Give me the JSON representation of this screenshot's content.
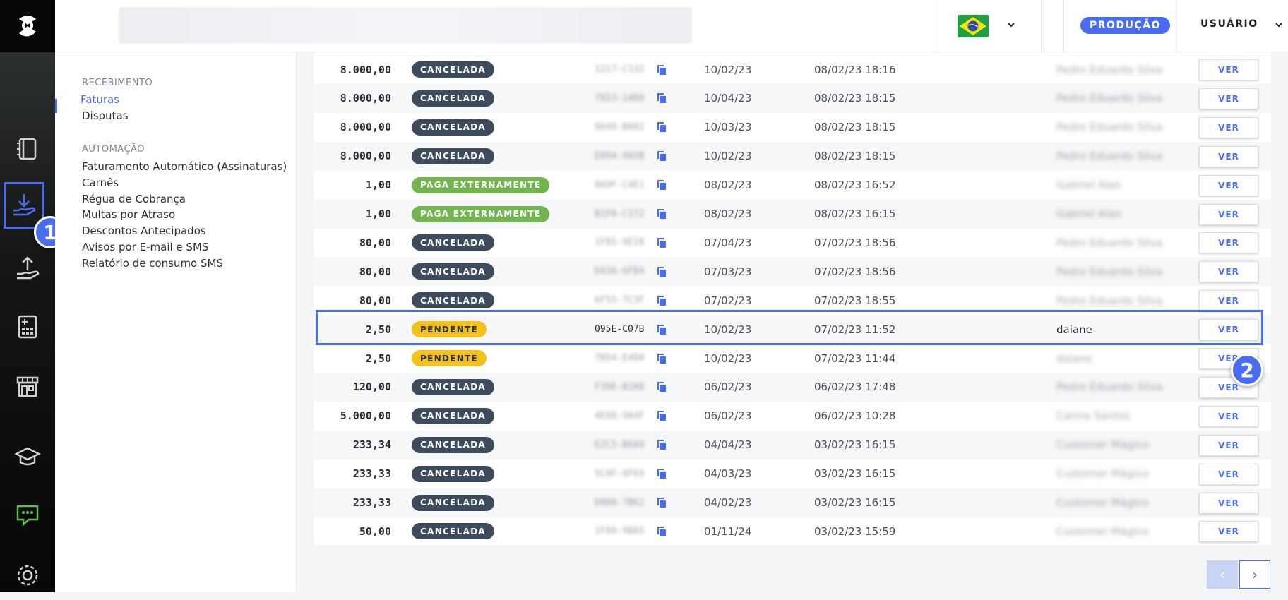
{
  "header": {
    "environment_badge": "PRODUÇÃO",
    "user_label": "USUÁRIO",
    "flag": "brazil-flag"
  },
  "sidebar_icons": [
    "logo-icon",
    "book-icon",
    "hand-receive-icon",
    "hand-pay-icon",
    "calculator-icon",
    "store-icon",
    "graduation-cap-icon",
    "chat-icon",
    "gear-icon"
  ],
  "subnav": {
    "sections": [
      {
        "title": "RECEBIMENTO",
        "items": [
          "Faturas",
          "Disputas"
        ]
      },
      {
        "title": "AUTOMAÇÃO",
        "items": [
          "Faturamento Automático (Assinaturas)",
          "Carnês",
          "Régua de Cobrança",
          "Multas por Atraso",
          "Descontos Antecipados",
          "Avisos por E-mail e SMS",
          "Relatório de consumo SMS"
        ]
      }
    ],
    "active_item": "Faturas"
  },
  "annotations": [
    "1",
    "2"
  ],
  "invoices": [
    {
      "amount": "8.000,00",
      "status": "CANCELADA",
      "status_type": "cancelada",
      "code": "1217-C132",
      "due": "10/02/23",
      "created": "08/02/23 18:16",
      "client": "Pedro Eduardo Silva",
      "action": "VER"
    },
    {
      "amount": "8.000,00",
      "status": "CANCELADA",
      "status_type": "cancelada",
      "code": "7853-1480",
      "due": "10/04/23",
      "created": "08/02/23 18:15",
      "client": "Pedro Eduardo Silva",
      "action": "VER"
    },
    {
      "amount": "8.000,00",
      "status": "CANCELADA",
      "status_type": "cancelada",
      "code": "9049-B802",
      "due": "10/03/23",
      "created": "08/02/23 18:15",
      "client": "Pedro Eduardo Silva",
      "action": "VER"
    },
    {
      "amount": "8.000,00",
      "status": "CANCELADA",
      "status_type": "cancelada",
      "code": "E094-9A5B",
      "due": "10/02/23",
      "created": "08/02/23 18:15",
      "client": "Pedro Eduardo Silva",
      "action": "VER"
    },
    {
      "amount": "1,00",
      "status": "PAGA EXTERNAMENTE",
      "status_type": "paga",
      "code": "8A9F-C4E1",
      "due": "08/02/23",
      "created": "08/02/23 16:52",
      "client": "Gabriel Alan",
      "action": "VER"
    },
    {
      "amount": "1,00",
      "status": "PAGA EXTERNAMENTE",
      "status_type": "paga",
      "code": "B1F0-C172",
      "due": "08/02/23",
      "created": "08/02/23 16:15",
      "client": "Gabriel Alan",
      "action": "VER"
    },
    {
      "amount": "80,00",
      "status": "CANCELADA",
      "status_type": "cancelada",
      "code": "1F85-9E18",
      "due": "07/04/23",
      "created": "07/02/23 18:56",
      "client": "Pedro Eduardo Silva",
      "action": "VER"
    },
    {
      "amount": "80,00",
      "status": "CANCELADA",
      "status_type": "cancelada",
      "code": "D43A-6FB4",
      "due": "07/03/23",
      "created": "07/02/23 18:56",
      "client": "Pedro Eduardo Silva",
      "action": "VER"
    },
    {
      "amount": "80,00",
      "status": "CANCELADA",
      "status_type": "cancelada",
      "code": "6F55-7C3F",
      "due": "07/02/23",
      "created": "07/02/23 18:55",
      "client": "Pedro Eduardo Silva",
      "action": "VER"
    },
    {
      "amount": "2,50",
      "status": "PENDENTE",
      "status_type": "pendente",
      "code": "095E-C07B",
      "due": "10/02/23",
      "created": "07/02/23 11:52",
      "client": "daiane",
      "action": "VER",
      "visible": true
    },
    {
      "amount": "2,50",
      "status": "PENDENTE",
      "status_type": "pendente",
      "code": "7B54-E480",
      "due": "10/02/23",
      "created": "07/02/23 11:44",
      "client": "daiane",
      "action": "VER"
    },
    {
      "amount": "120,00",
      "status": "CANCELADA",
      "status_type": "cancelada",
      "code": "F39E-B2A8",
      "due": "06/02/23",
      "created": "06/02/23 17:48",
      "client": "Pedro Eduardo Silva",
      "action": "VER"
    },
    {
      "amount": "5.000,00",
      "status": "CANCELADA",
      "status_type": "cancelada",
      "code": "4E08-9A4F",
      "due": "06/02/23",
      "created": "06/02/23 10:28",
      "client": "Carine Santos",
      "action": "VER"
    },
    {
      "amount": "233,34",
      "status": "CANCELADA",
      "status_type": "cancelada",
      "code": "E2C5-B6A9",
      "due": "04/04/23",
      "created": "03/02/23 16:15",
      "client": "Customer Mágico",
      "action": "VER"
    },
    {
      "amount": "233,33",
      "status": "CANCELADA",
      "status_type": "cancelada",
      "code": "5C4F-8F69",
      "due": "04/03/23",
      "created": "03/02/23 16:15",
      "client": "Customer Mágico",
      "action": "VER"
    },
    {
      "amount": "233,33",
      "status": "CANCELADA",
      "status_type": "cancelada",
      "code": "D88A-7B62",
      "due": "04/02/23",
      "created": "03/02/23 16:15",
      "client": "Customer Mágico",
      "action": "VER"
    },
    {
      "amount": "50,00",
      "status": "CANCELADA",
      "status_type": "cancelada",
      "code": "1F80-9BA5",
      "due": "01/11/24",
      "created": "03/02/23 15:59",
      "client": "Customer Mágico",
      "action": "VER"
    }
  ],
  "pager": {
    "prev": "‹",
    "next": "›"
  },
  "colors": {
    "accent": "#4a6cf0",
    "cancelada": "#3d4b5c",
    "paga": "#72b44f",
    "pendente": "#f2c21b"
  }
}
